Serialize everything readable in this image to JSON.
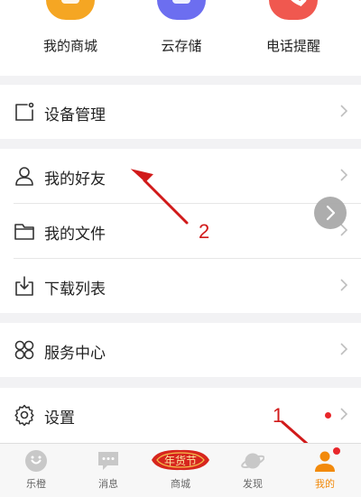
{
  "shortcuts": [
    {
      "label": "我的商城",
      "icon": "mall-icon",
      "color": "#f5a623"
    },
    {
      "label": "云存储",
      "icon": "cloud-storage-icon",
      "color": "#6c6ef0"
    },
    {
      "label": "电话提醒",
      "icon": "phone-icon",
      "color": "#f0584f"
    }
  ],
  "menu": {
    "device": {
      "label": "设备管理",
      "icon": "device-icon"
    },
    "friends": {
      "label": "我的好友",
      "icon": "person-icon"
    },
    "files": {
      "label": "我的文件",
      "icon": "folder-icon"
    },
    "downloads": {
      "label": "下载列表",
      "icon": "download-icon"
    },
    "service": {
      "label": "服务中心",
      "icon": "service-icon"
    },
    "settings": {
      "label": "设置",
      "icon": "gear-icon"
    }
  },
  "annotations": {
    "one": "1",
    "two": "2",
    "arrow_color": "#d11a1a"
  },
  "nav": {
    "items": [
      {
        "label": "乐橙",
        "icon": "lechange-icon"
      },
      {
        "label": "消息",
        "icon": "message-icon"
      },
      {
        "label": "商城",
        "icon": "mall-badge-icon",
        "badge": "年货节"
      },
      {
        "label": "发现",
        "icon": "planet-icon"
      },
      {
        "label": "我的",
        "icon": "profile-icon"
      }
    ],
    "active": "我的",
    "accent": "#f28a0c"
  }
}
